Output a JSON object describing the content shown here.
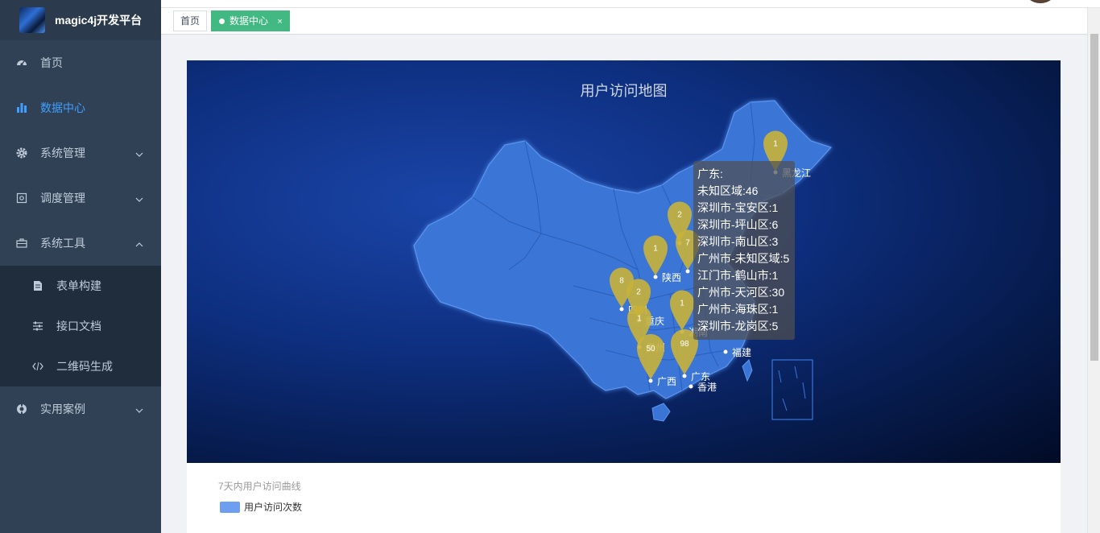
{
  "app": {
    "title": "magic4j开发平台"
  },
  "sidebar": {
    "items": [
      {
        "label": "首页",
        "icon": "dashboard-icon"
      },
      {
        "label": "数据中心",
        "icon": "bar-chart-icon"
      },
      {
        "label": "系统管理",
        "icon": "gear-icon"
      },
      {
        "label": "调度管理",
        "icon": "monitor-icon"
      },
      {
        "label": "系统工具",
        "icon": "toolbox-icon"
      }
    ],
    "subitems": [
      {
        "label": "表单构建",
        "icon": "form-icon"
      },
      {
        "label": "接口文档",
        "icon": "sliders-icon"
      },
      {
        "label": "二维码生成",
        "icon": "code-icon"
      }
    ],
    "last_item": {
      "label": "实用案例",
      "icon": "compass-icon"
    }
  },
  "tags": [
    {
      "label": "首页"
    },
    {
      "label": "数据中心",
      "close": "×"
    }
  ],
  "map": {
    "title": "用户访问地图",
    "tooltip": {
      "lines": [
        "广东:",
        "未知区域:46",
        "深圳市-宝安区:1",
        "深圳市-坪山区:6",
        "深圳市-南山区:3",
        "广州市-未知区域:5",
        "江门市-鹤山市:1",
        "广州市-天河区:30",
        "广州市-海珠区:1",
        "深圳市-龙岗区:5"
      ]
    },
    "pins": [
      {
        "value": "1",
        "label": "黑龙江"
      },
      {
        "value": "2",
        "label": ""
      },
      {
        "value": "7",
        "label": ""
      },
      {
        "value": "1",
        "label": "陕西"
      },
      {
        "value": "8",
        "label": "四川"
      },
      {
        "value": "2",
        "label": "重庆"
      },
      {
        "value": "1",
        "label": "贵州"
      },
      {
        "value": "1",
        "label": "湖南"
      },
      {
        "value": "50",
        "label": "广西"
      },
      {
        "value": "98",
        "label": "广东"
      },
      {
        "value": "",
        "label": "福建"
      },
      {
        "value": "",
        "label": "香港"
      }
    ],
    "colors": {
      "land": "#3a75d6",
      "border": "#2a5fba",
      "pin": "#c8b33a",
      "label": "#ffffff"
    }
  },
  "line_chart": {
    "title": "7天内用户访问曲线",
    "legend": "用户访问次数",
    "color": "#6e9ef0"
  }
}
